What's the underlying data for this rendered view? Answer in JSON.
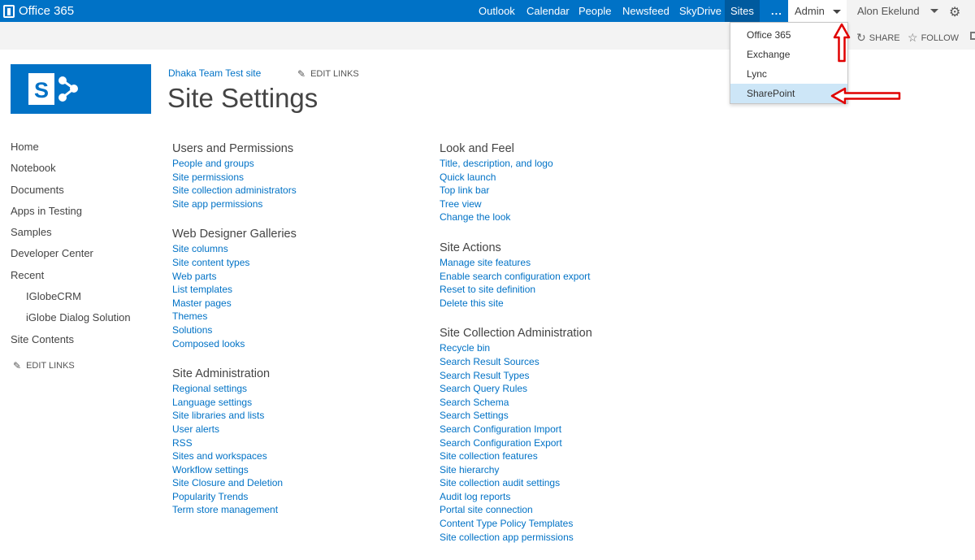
{
  "suite_bar": {
    "brand": "Office 365",
    "nav": [
      "Outlook",
      "Calendar",
      "People",
      "Newsfeed",
      "SkyDrive",
      "Sites"
    ],
    "more": "...",
    "admin": "Admin",
    "user": "Alon Ekelund"
  },
  "ribbon": {
    "share": "SHARE",
    "follow": "FOLLOW"
  },
  "admin_menu": {
    "items": [
      "Office 365",
      "Exchange",
      "Lync",
      "SharePoint"
    ],
    "highlighted": "SharePoint"
  },
  "site": {
    "breadcrumb": "Dhaka Team Test site",
    "edit_links": "EDIT LINKS",
    "title": "Site Settings"
  },
  "quick_launch": {
    "items": [
      "Home",
      "Notebook",
      "Documents",
      "Apps in Testing",
      "Samples",
      "Developer Center",
      "Recent"
    ],
    "recent_items": [
      "IGlobeCRM",
      "iGlobe Dialog Solution"
    ],
    "site_contents": "Site Contents",
    "edit_links": "EDIT LINKS"
  },
  "sections": {
    "users_permissions": {
      "title": "Users and Permissions",
      "links": [
        "People and groups",
        "Site permissions",
        "Site collection administrators",
        "Site app permissions"
      ]
    },
    "web_designer_galleries": {
      "title": "Web Designer Galleries",
      "links": [
        "Site columns",
        "Site content types",
        "Web parts",
        "List templates",
        "Master pages",
        "Themes",
        "Solutions",
        "Composed looks"
      ]
    },
    "site_administration": {
      "title": "Site Administration",
      "links": [
        "Regional settings",
        "Language settings",
        "Site libraries and lists",
        "User alerts",
        "RSS",
        "Sites and workspaces",
        "Workflow settings",
        "Site Closure and Deletion",
        "Popularity Trends",
        "Term store management"
      ]
    },
    "look_and_feel": {
      "title": "Look and Feel",
      "links": [
        "Title, description, and logo",
        "Quick launch",
        "Top link bar",
        "Tree view",
        "Change the look"
      ]
    },
    "site_actions": {
      "title": "Site Actions",
      "links": [
        "Manage site features",
        "Enable search configuration export",
        "Reset to site definition",
        "Delete this site"
      ]
    },
    "site_collection_administration": {
      "title": "Site Collection Administration",
      "links": [
        "Recycle bin",
        "Search Result Sources",
        "Search Result Types",
        "Search Query Rules",
        "Search Schema",
        "Search Settings",
        "Search Configuration Import",
        "Search Configuration Export",
        "Site collection features",
        "Site hierarchy",
        "Site collection audit settings",
        "Audit log reports",
        "Portal site connection",
        "Content Type Policy Templates",
        "Site collection app permissions"
      ]
    }
  },
  "colors": {
    "suite_blue": "#0072c6",
    "link_blue": "#0072c6",
    "annotation_red": "#e00000",
    "menu_highlight": "#cde6f7"
  }
}
